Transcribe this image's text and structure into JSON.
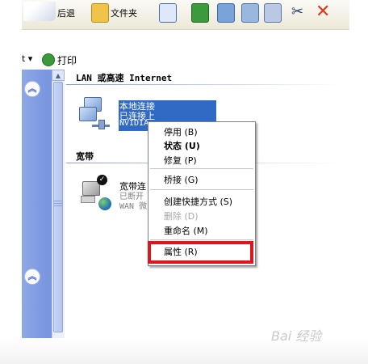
{
  "toolbar": {
    "back_label": "后退",
    "folders_label": "文件夹"
  },
  "taskbar": {
    "dropdown_label": "t ▾",
    "print_label": "打印"
  },
  "left_pane": {
    "collapse_top_glyph": "︽",
    "collapse_bottom_glyph": "︽"
  },
  "groups": {
    "lan": {
      "header": "LAN 或高速 Internet",
      "connection": {
        "name": "本地连接",
        "status": "已连接上",
        "device": "NVIDIA"
      }
    },
    "broadband": {
      "header": "宽带",
      "connection": {
        "name": "宽带连",
        "status": "已断开",
        "device": "WAN 微"
      }
    }
  },
  "context_menu": {
    "items": [
      {
        "label": "停用 (B)",
        "enabled": true
      },
      {
        "label": "状态 (U)",
        "enabled": true,
        "default": true
      },
      {
        "label": "修复 (P)",
        "enabled": true
      },
      {
        "label": "桥接 (G)",
        "enabled": true
      },
      {
        "label": "创建快捷方式 (S)",
        "enabled": true
      },
      {
        "label": "删除 (D)",
        "enabled": false
      },
      {
        "label": "重命名 (M)",
        "enabled": true
      },
      {
        "label": "属性 (R)",
        "enabled": true,
        "highlighted": true
      }
    ]
  },
  "watermark": "Bai 经验",
  "colors": {
    "selection": "#316ac5",
    "highlight_border": "#e0141c",
    "task_pane": "#7a96df"
  }
}
